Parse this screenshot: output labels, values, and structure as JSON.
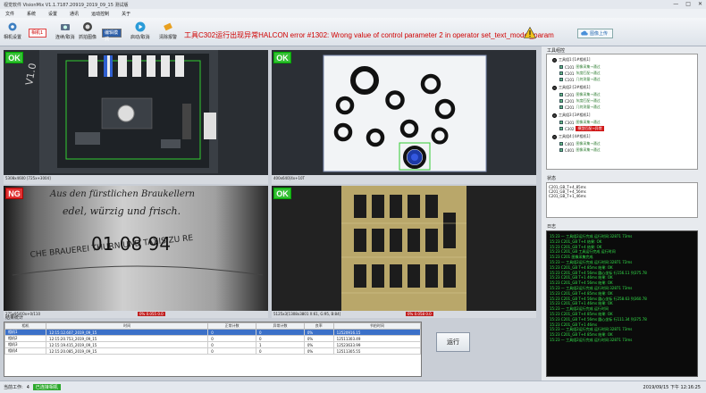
{
  "window": {
    "title": "视觉软件 VisionMix  V1.1.7187.20919_2019_09_15 测试版",
    "minimize": "—",
    "maximize": "□",
    "close": "✕"
  },
  "menu": [
    "文件",
    "系统",
    "设置",
    "通讯",
    "运动控制",
    "关于"
  ],
  "toolbar": {
    "camera_settings": "相机设置",
    "camera_value": "相机1",
    "continuous": "连续/取消",
    "capture": "抓拍图像",
    "mode_value": "编辑模式",
    "open_close": "启动/取消",
    "clear_alarm": "清除报警",
    "error_message": "工具C302运行出现异常HALCON error #1302: Wrong value of control parameter 2 in operator set_text_model_param",
    "cloud_label": "图像上传",
    "icons": [
      "gear-icon",
      "camera-icon",
      "capture-icon",
      "play-icon",
      "eraser-icon",
      "warning-icon",
      "cloud-icon"
    ]
  },
  "panels": [
    {
      "status": "OK",
      "caption": "5308x4600  [725x+3004]"
    },
    {
      "status": "OK",
      "caption": "400x640[4x+10T"
    },
    {
      "status": "NG",
      "caption": "275x954[0x+0/110",
      "red_caption": "0% 0.055 0.0"
    },
    {
      "status": "OK",
      "caption": "5125x3[1308x3801 X:61, G:95, B:84]",
      "red_caption": "0% 0.058 0.0"
    }
  ],
  "right": {
    "tree_label": "工具组控",
    "tree": [
      {
        "level": 0,
        "code": "工具组1:[1#相机1]",
        "text": ""
      },
      {
        "level": 1,
        "code": "C101",
        "text": "图像采集→通过"
      },
      {
        "level": 1,
        "code": "C101",
        "text": "灰度匹配→通过"
      },
      {
        "level": 1,
        "code": "C101",
        "text": "几何测量→通过"
      },
      {
        "level": 0,
        "code": "工具组2:[2#相机1]",
        "text": ""
      },
      {
        "level": 1,
        "code": "C201",
        "text": "图像采集→通过"
      },
      {
        "level": 1,
        "code": "C201",
        "text": "灰度匹配→通过"
      },
      {
        "level": 1,
        "code": "C201",
        "text": "几何测量→通过"
      },
      {
        "level": 0,
        "code": "工具组3:[3#相机1]",
        "text": ""
      },
      {
        "level": 1,
        "code": "C301",
        "text": "图像采集→通过"
      },
      {
        "level": 1,
        "code": "C302",
        "text": "模型匹配→异常",
        "highlight": true
      },
      {
        "level": 0,
        "code": "工具组4:[4#相机1]",
        "text": ""
      },
      {
        "level": 1,
        "code": "C401",
        "text": "图像采集→通过"
      },
      {
        "level": 1,
        "code": "C401",
        "text": "图像采集→通过"
      }
    ],
    "status_label": "状态",
    "status_lines": [
      "C201_GB_T+4_85ms",
      "C201_GB_T+4_56ms",
      "C201_GB_T+1_46ms"
    ],
    "log_label": "日志",
    "log_lines": [
      "15:23 — 工具组2运行完成 运行时间:32871 73ms",
      "15:23 C201_GB T+4 结果: OK",
      "15:23 C201_GB T+4 结果: OK",
      "15:23 C201_GB 工具运行完成 运行时间",
      "15:23 C201 图像采集完成",
      "15:23 — 工具组2运行完成 运行时间:32871 72ms",
      "15:23 C201_GB T+4 85ms 结果: OK",
      "15:23 C201_GB T+4 56ms 圆心坐标 行156.11 列375.78",
      "15:23 C201_GB T+1 46ms 结果: OK",
      "15:23 C201_GB T+4 56ms 结果: OK",
      "15:23 — 工具组2运行完成 运行时间:32871 73ms",
      "15:23 C201_GB T+4 85ms 结果: OK",
      "15:23 C201_GB T+4 56ms 圆心坐标 行258.63 列360.78",
      "15:23 C201_GB T+1 46ms 结果: OK",
      "15:23 — 工具组2运行完成 运行时间",
      "15:23 C201_GB T+4 85ms 结果: OK",
      "15:23 C201_GB T+4 56ms 圆心坐标 行111.34 列375.78",
      "15:23 C201_GB T+1 46ms",
      "15:23 — 工具组2运行完成 运行时间:32871 73ms",
      "15:23 C201_GB T+4 85ms 结果: OK",
      "15:23 — 工具组2运行完成 运行时间:32871 73ms"
    ]
  },
  "results": {
    "label": "结果统计",
    "headers": [
      "相机",
      "时间",
      "正常计数",
      "异常计数",
      "良率",
      "节拍时间"
    ],
    "rows": [
      [
        "相机1",
        "12:15:12.607_2019_09_15",
        "0",
        "0",
        "0%",
        "12520916.15"
      ],
      [
        "相机2",
        "12:15:20.753_2019_09_15",
        "0",
        "0",
        "0%",
        "12511303.49"
      ],
      [
        "相机3",
        "12:15:19.415_2019_09_15",
        "0",
        "1",
        "0%",
        "12523633.99"
      ],
      [
        "相机4",
        "12:15:20.085_2019_09_15",
        "0",
        "0",
        "0%",
        "12511305.55"
      ]
    ]
  },
  "run_button": "运行",
  "statusbar": {
    "left": "当前工作:",
    "num": "4",
    "state": "已连接相机",
    "datetime": "2019/09/15 下午 12:16:25"
  }
}
